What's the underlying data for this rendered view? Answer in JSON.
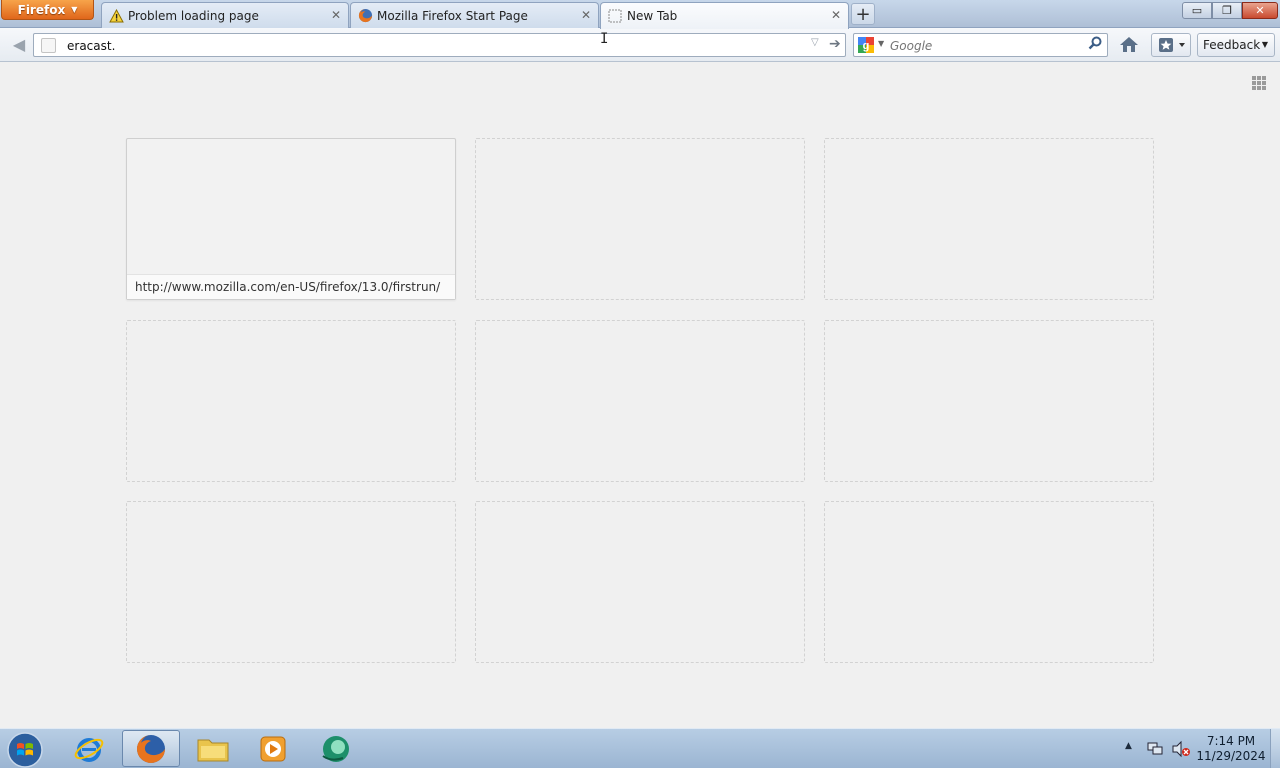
{
  "browser": {
    "menu_button_label": "Firefox",
    "tabs": [
      {
        "title": "Problem loading page",
        "icon": "warning-icon",
        "active": false
      },
      {
        "title": "Mozilla Firefox Start Page",
        "icon": "firefox-icon",
        "active": false
      },
      {
        "title": "New Tab",
        "icon": "blank-page-icon",
        "active": true
      }
    ],
    "new_tab_label": "+",
    "window_controls": {
      "minimize": "▭",
      "maximize": "❐",
      "close": "✕"
    }
  },
  "navbar": {
    "url_value": "eracast.",
    "search_engine": "Google",
    "search_placeholder": "Google",
    "feedback_label": "Feedback"
  },
  "new_tab_page": {
    "tiles": [
      {
        "url": "http://www.mozilla.com/en-US/firefox/13.0/firstrun/"
      },
      {
        "url": ""
      },
      {
        "url": ""
      },
      {
        "url": ""
      },
      {
        "url": ""
      },
      {
        "url": ""
      },
      {
        "url": ""
      },
      {
        "url": ""
      },
      {
        "url": ""
      }
    ]
  },
  "taskbar": {
    "pinned": [
      {
        "name": "internet-explorer-icon"
      },
      {
        "name": "firefox-icon",
        "active": true
      },
      {
        "name": "file-explorer-icon"
      },
      {
        "name": "media-player-icon"
      },
      {
        "name": "green-app-icon"
      }
    ],
    "clock_time": "7:14 PM",
    "clock_date": "11/29/2024"
  },
  "colors": {
    "firefox_orange": "#e0661b",
    "chrome_blue": "#aebfd6",
    "page_bg": "#f0f0f0",
    "taskbar_blue": "#9bb5d2"
  }
}
